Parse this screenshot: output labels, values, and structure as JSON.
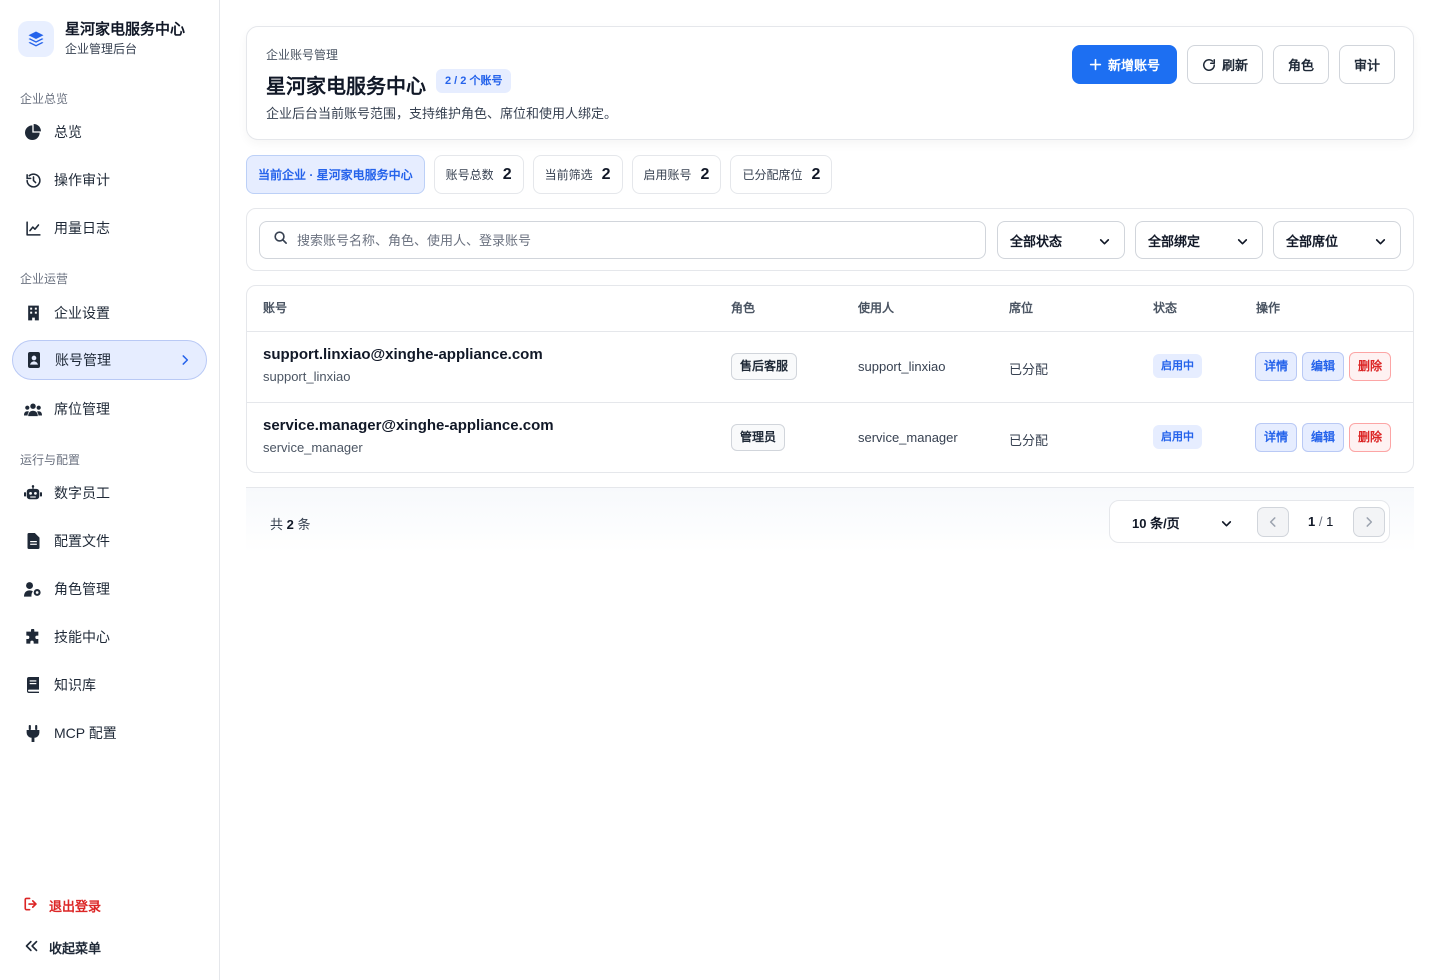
{
  "brand": {
    "title": "星河家电服务中心",
    "subtitle": "企业管理后台"
  },
  "sidebar": {
    "sections": [
      {
        "label": "企业总览"
      },
      {
        "label": "企业运营"
      },
      {
        "label": "运行与配置"
      }
    ],
    "items": [
      {
        "label": "总览",
        "icon": "pie-chart-icon"
      },
      {
        "label": "操作审计",
        "icon": "history-icon"
      },
      {
        "label": "用量日志",
        "icon": "line-chart-icon"
      },
      {
        "label": "企业设置",
        "icon": "building-icon"
      },
      {
        "label": "账号管理",
        "icon": "id-badge-icon",
        "active": true
      },
      {
        "label": "席位管理",
        "icon": "users-icon"
      },
      {
        "label": "数字员工",
        "icon": "robot-icon"
      },
      {
        "label": "配置文件",
        "icon": "file-icon"
      },
      {
        "label": "角色管理",
        "icon": "user-gear-icon"
      },
      {
        "label": "技能中心",
        "icon": "puzzle-icon"
      },
      {
        "label": "知识库",
        "icon": "book-icon"
      },
      {
        "label": "MCP 配置",
        "icon": "plug-icon"
      }
    ],
    "logout": "退出登录",
    "collapse": "收起菜单"
  },
  "header": {
    "crumb": "企业账号管理",
    "title": "星河家电服务中心",
    "badge": "2 / 2 个账号",
    "desc": "企业后台当前账号范围，支持维护角色、席位和使用人绑定。",
    "actions": {
      "add": "新增账号",
      "refresh": "刷新",
      "roles": "角色",
      "audit": "审计"
    }
  },
  "stats": {
    "current": "当前企业 · 星河家电服务中心",
    "items": [
      {
        "label": "账号总数",
        "value": "2"
      },
      {
        "label": "当前筛选",
        "value": "2"
      },
      {
        "label": "启用账号",
        "value": "2"
      },
      {
        "label": "已分配席位",
        "value": "2"
      }
    ]
  },
  "filters": {
    "search_placeholder": "搜索账号名称、角色、使用人、登录账号",
    "status": "全部状态",
    "binding": "全部绑定",
    "seat": "全部席位"
  },
  "table": {
    "headers": {
      "account": "账号",
      "role": "角色",
      "user": "使用人",
      "seat": "席位",
      "status": "状态",
      "ops": "操作"
    },
    "rows": [
      {
        "account": "support.linxiao@xinghe-appliance.com",
        "login": "support_linxiao",
        "role": "售后客服",
        "user": "support_linxiao",
        "seat": "已分配",
        "status": "启用中"
      },
      {
        "account": "service.manager@xinghe-appliance.com",
        "login": "service_manager",
        "role": "管理员",
        "user": "service_manager",
        "seat": "已分配",
        "status": "启用中"
      }
    ],
    "ops": {
      "detail": "详情",
      "edit": "编辑",
      "delete": "删除"
    }
  },
  "pager": {
    "total_prefix": "共",
    "total": "2",
    "total_suffix": "条",
    "page_size": "10 条/页",
    "current": "1",
    "sep": "/",
    "pages": "1"
  },
  "colors": {
    "accent": "#1d6ff2",
    "accent_soft": "#e6edff",
    "danger": "#dc2626"
  }
}
